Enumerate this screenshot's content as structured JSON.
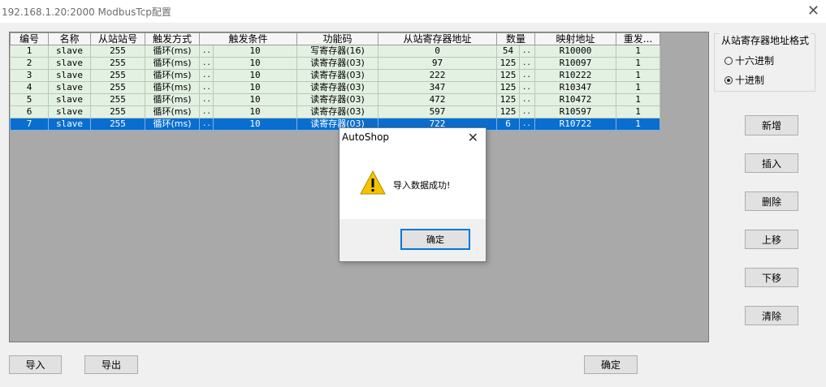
{
  "window": {
    "title": "192.168.1.20:2000 ModbusTcp配置",
    "close_glyph": "✕"
  },
  "grid": {
    "columns": [
      "编号",
      "名称",
      "从站站号",
      "触发方式",
      "触发条件",
      "功能码",
      "从站寄存器地址",
      "数量",
      "映射地址",
      "重发..."
    ],
    "rows": [
      {
        "no": "1",
        "name": "slave",
        "station": "255",
        "trigger": "循环(ms)",
        "dots": "..",
        "cond": "10",
        "func": "写寄存器(16)",
        "addr": "0",
        "count": "54",
        "dots2": "..",
        "map": "R10000",
        "retry": "1"
      },
      {
        "no": "2",
        "name": "slave",
        "station": "255",
        "trigger": "循环(ms)",
        "dots": "..",
        "cond": "10",
        "func": "读寄存器(03)",
        "addr": "97",
        "count": "125",
        "dots2": "..",
        "map": "R10097",
        "retry": "1"
      },
      {
        "no": "3",
        "name": "slave",
        "station": "255",
        "trigger": "循环(ms)",
        "dots": "..",
        "cond": "10",
        "func": "读寄存器(03)",
        "addr": "222",
        "count": "125",
        "dots2": "..",
        "map": "R10222",
        "retry": "1"
      },
      {
        "no": "4",
        "name": "slave",
        "station": "255",
        "trigger": "循环(ms)",
        "dots": "..",
        "cond": "10",
        "func": "读寄存器(03)",
        "addr": "347",
        "count": "125",
        "dots2": "..",
        "map": "R10347",
        "retry": "1"
      },
      {
        "no": "5",
        "name": "slave",
        "station": "255",
        "trigger": "循环(ms)",
        "dots": "..",
        "cond": "10",
        "func": "读寄存器(03)",
        "addr": "472",
        "count": "125",
        "dots2": "..",
        "map": "R10472",
        "retry": "1"
      },
      {
        "no": "6",
        "name": "slave",
        "station": "255",
        "trigger": "循环(ms)",
        "dots": "..",
        "cond": "10",
        "func": "读寄存器(03)",
        "addr": "597",
        "count": "125",
        "dots2": "..",
        "map": "R10597",
        "retry": "1"
      },
      {
        "no": "7",
        "name": "slave",
        "station": "255",
        "trigger": "循环(ms)",
        "dots": "..",
        "cond": "10",
        "func": "读寄存器(03)",
        "addr": "722",
        "count": "6",
        "dots2": "..",
        "map": "R10722",
        "retry": "1"
      }
    ],
    "selected_row": 6
  },
  "format_group": {
    "legend": "从站寄存器地址格式",
    "hex_label": "十六进制",
    "dec_label": "十进制",
    "selected": "dec"
  },
  "side_buttons": {
    "add": "新增",
    "insert": "插入",
    "delete": "删除",
    "up": "上移",
    "down": "下移",
    "clear": "清除"
  },
  "bottom_buttons": {
    "import": "导入",
    "export": "导出",
    "ok": "确定"
  },
  "dialog": {
    "title": "AutoShop",
    "close_glyph": "✕",
    "icon": "warning-icon",
    "message": "导入数据成功!",
    "ok_label": "确定"
  },
  "colors": {
    "row_bg": "#e3f1e2",
    "selected_bg": "#0a6ed1",
    "grid_bg": "#a9a9a9",
    "warning": "#f5c400"
  }
}
